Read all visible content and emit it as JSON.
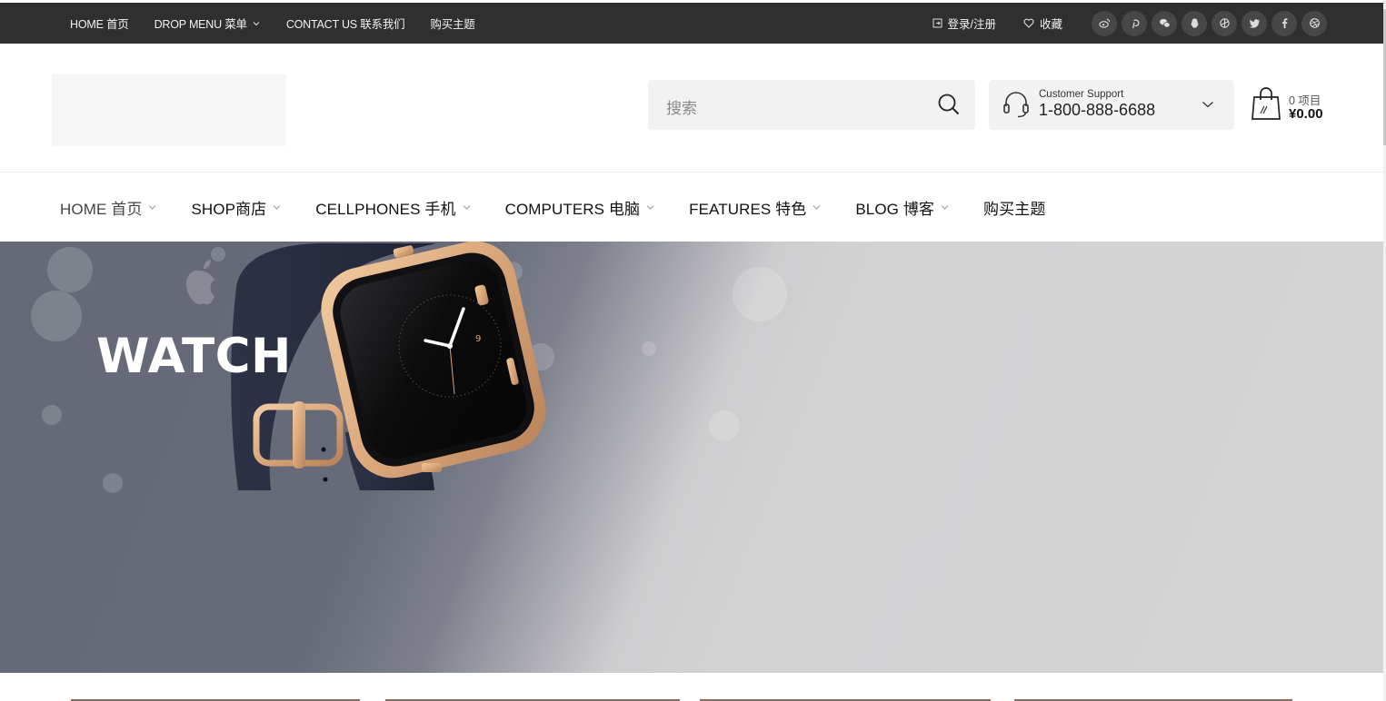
{
  "topbar": {
    "nav": [
      {
        "label": "HOME 首页",
        "has_caret": false
      },
      {
        "label": "DROP MENU 菜单",
        "has_caret": true
      },
      {
        "label": "CONTACT US 联系我们",
        "has_caret": false
      },
      {
        "label": "购买主题",
        "has_caret": false
      }
    ],
    "account_label": "登录/注册",
    "wishlist_label": "收藏",
    "social_icons": [
      "weibo-icon",
      "pinterest-icon",
      "wechat-icon",
      "qq-icon",
      "tencent-icon",
      "twitter-icon",
      "facebook-icon",
      "dribbble-icon"
    ],
    "background_color": "#2f2f2f"
  },
  "header": {
    "search_placeholder": "搜索",
    "support_label": "Customer Support",
    "support_phone": "1-800-888-6688",
    "cart_count": "0 项目",
    "cart_total": "¥0.00"
  },
  "mainnav": {
    "items": [
      {
        "label": "HOME 首页",
        "has_caret": true,
        "active": true
      },
      {
        "label": "SHOP商店",
        "has_caret": true,
        "active": false
      },
      {
        "label": "CELLPHONES 手机",
        "has_caret": true,
        "active": false
      },
      {
        "label": "COMPUTERS 电脑",
        "has_caret": true,
        "active": false
      },
      {
        "label": "FEATURES 特色",
        "has_caret": true,
        "active": false
      },
      {
        "label": "BLOG 博客",
        "has_caret": true,
        "active": false
      },
      {
        "label": "购买主题",
        "has_caret": false,
        "active": false
      }
    ]
  },
  "hero": {
    "title": "WATCH",
    "watch_numeral": "9",
    "colors": {
      "left": "#666a78",
      "right": "#d4d4d5",
      "band": "#1f2436",
      "case": "#d9a77a"
    }
  }
}
